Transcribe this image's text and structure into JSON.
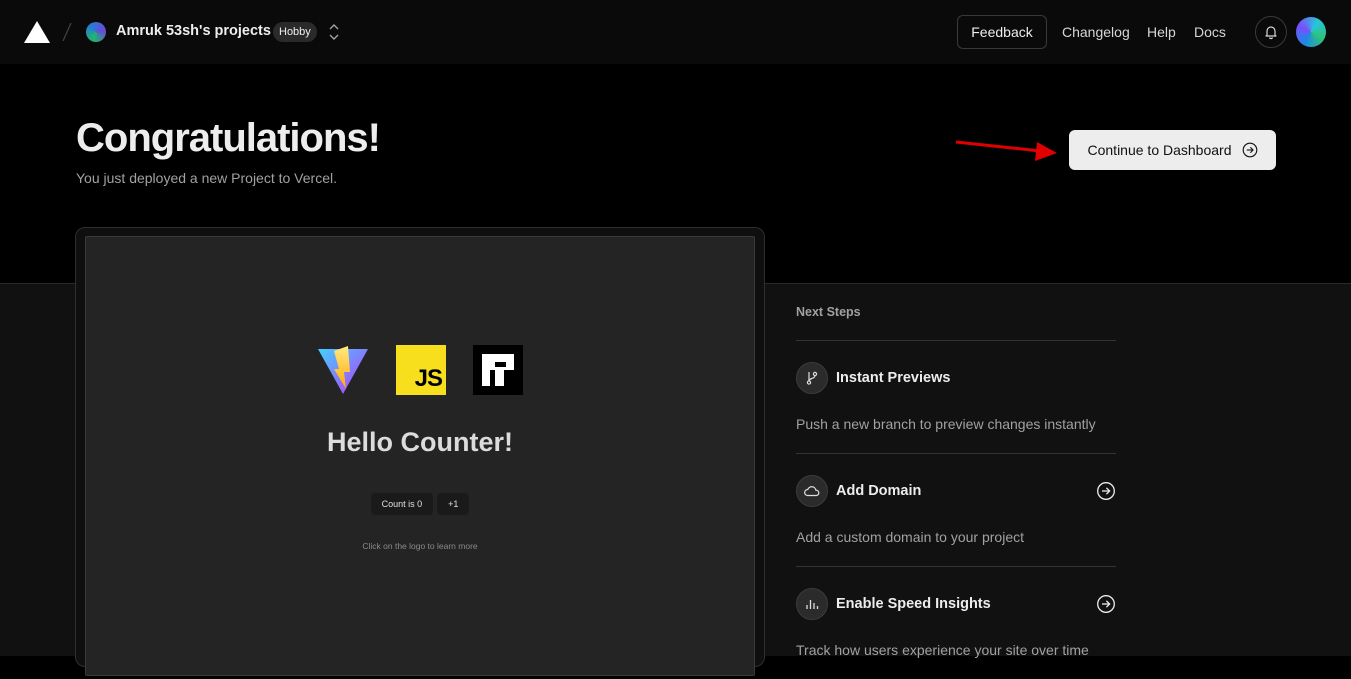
{
  "nav": {
    "team_name": "Amruk 53sh's projects",
    "plan_badge": "Hobby",
    "feedback_label": "Feedback",
    "links": {
      "changelog": "Changelog",
      "help": "Help",
      "docs": "Docs"
    },
    "icons": {
      "logo": "vercel-triangle-icon",
      "switcher": "chevron-up-down-icon",
      "notifications": "bell-icon"
    }
  },
  "hero": {
    "title": "Congratulations!",
    "subtitle": "You just deployed a new Project to Vercel.",
    "continue_label": "Continue to Dashboard",
    "continue_icon": "arrow-right-circle-icon",
    "annotation_color": "#e00000"
  },
  "preview": {
    "heading": "Hello Counter!",
    "count_button": "Count is 0",
    "increment_button": "+1",
    "hint": "Click on the logo to learn more",
    "js_logo_text": "JS",
    "logos": [
      "vite-logo",
      "javascript-logo",
      "raw-logo"
    ]
  },
  "next_steps": {
    "title": "Next Steps",
    "items": [
      {
        "title": "Instant Previews",
        "description": "Push a new branch to preview changes instantly",
        "icon": "git-branch-icon",
        "has_arrow": false
      },
      {
        "title": "Add Domain",
        "description": "Add a custom domain to your project",
        "icon": "cloud-icon",
        "has_arrow": true
      },
      {
        "title": "Enable Speed Insights",
        "description": "Track how users experience your site over time",
        "icon": "bar-chart-icon",
        "has_arrow": true
      }
    ]
  },
  "colors": {
    "background": "#000000",
    "surface": "#111111",
    "primary_button": "#ededed",
    "text": "#ededed",
    "muted_text": "#a1a1a1"
  }
}
